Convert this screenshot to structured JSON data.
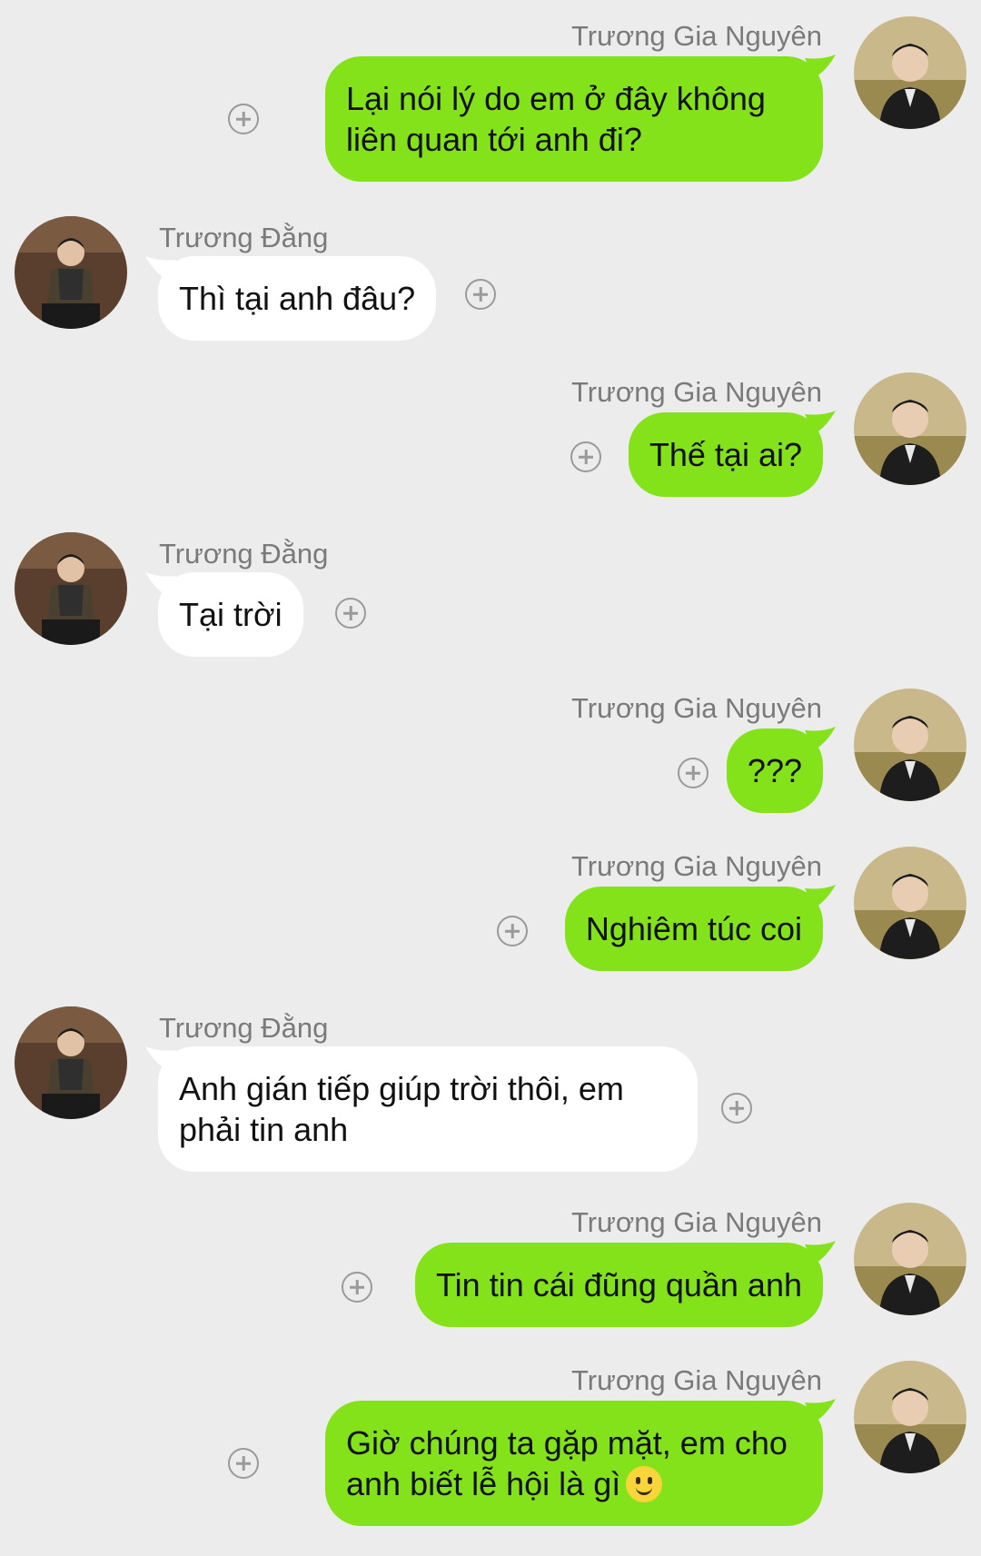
{
  "messages": [
    {
      "side": "right",
      "sender": "Trương Gia Nguyên",
      "text": "Lại nói lý do em ở đây không liên quan tới anh đi?"
    },
    {
      "side": "left",
      "sender": "Trương Đằng",
      "text": "Thì tại anh đâu?"
    },
    {
      "side": "right",
      "sender": "Trương Gia Nguyên",
      "text": "Thế tại ai?"
    },
    {
      "side": "left",
      "sender": "Trương Đằng",
      "text": "Tại trời"
    },
    {
      "side": "right",
      "sender": "Trương Gia Nguyên",
      "text": "???"
    },
    {
      "side": "right",
      "sender": "Trương Gia Nguyên",
      "text": "Nghiêm túc coi"
    },
    {
      "side": "left",
      "sender": "Trương Đằng",
      "text": "Anh gián tiếp giúp trời thôi, em phải tin anh"
    },
    {
      "side": "right",
      "sender": "Trương Gia Nguyên",
      "text": "Tin tin cái đũng quần anh"
    },
    {
      "side": "right",
      "sender": "Trương Gia Nguyên",
      "text": "Giờ chúng ta gặp mặt, em cho anh biết lễ hội là gì",
      "emoji": "slightly-smiling-face-emoji"
    }
  ],
  "icons": {
    "add": "plus-circle-icon",
    "avatar_right": "avatar-truong-gia-nguyen",
    "avatar_left": "avatar-truong-dang"
  },
  "colors": {
    "background": "#ececec",
    "outgoing_bubble": "#84e21b",
    "incoming_bubble": "#ffffff",
    "sender_name": "#7a7a7a",
    "icon": "#9a9a9a"
  }
}
